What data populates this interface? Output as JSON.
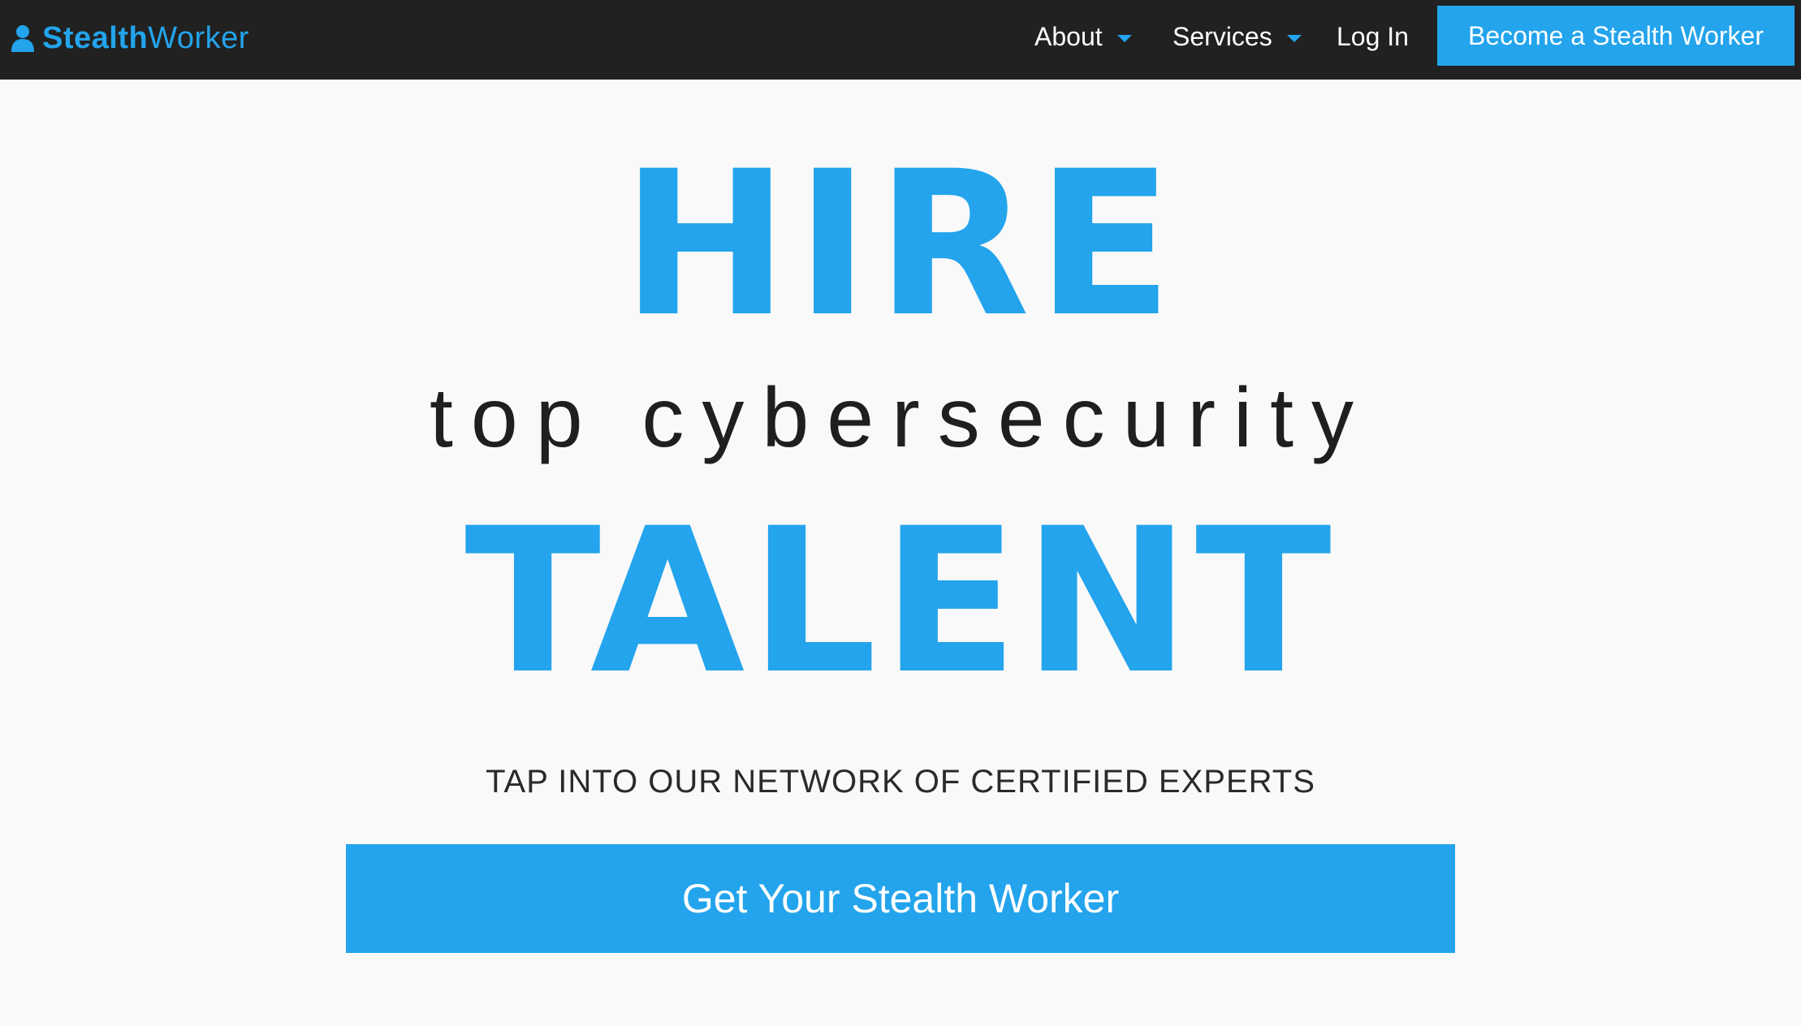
{
  "navbar": {
    "brand": {
      "bold": "Stealth",
      "light": "Worker",
      "icon": "user-icon"
    },
    "items": [
      {
        "label": "About",
        "icon": "caret-down-icon"
      },
      {
        "label": "Services",
        "icon": "caret-down-icon"
      },
      {
        "label": "Log In"
      }
    ],
    "cta_label": "Become a Stealth Worker"
  },
  "hero": {
    "headline_top": "HIRE",
    "subheadline": "top cybersecurity",
    "headline_bottom": "TALENT",
    "tagline": "TAP INTO OUR NETWORK OF CERTIFIED EXPERTS",
    "cta_label": "Get Your Stealth Worker"
  },
  "colors": {
    "accent": "#23a4ec",
    "navbar_bg": "#212121",
    "page_bg": "#f9f9f9",
    "text_dark": "#1f1f1f"
  }
}
